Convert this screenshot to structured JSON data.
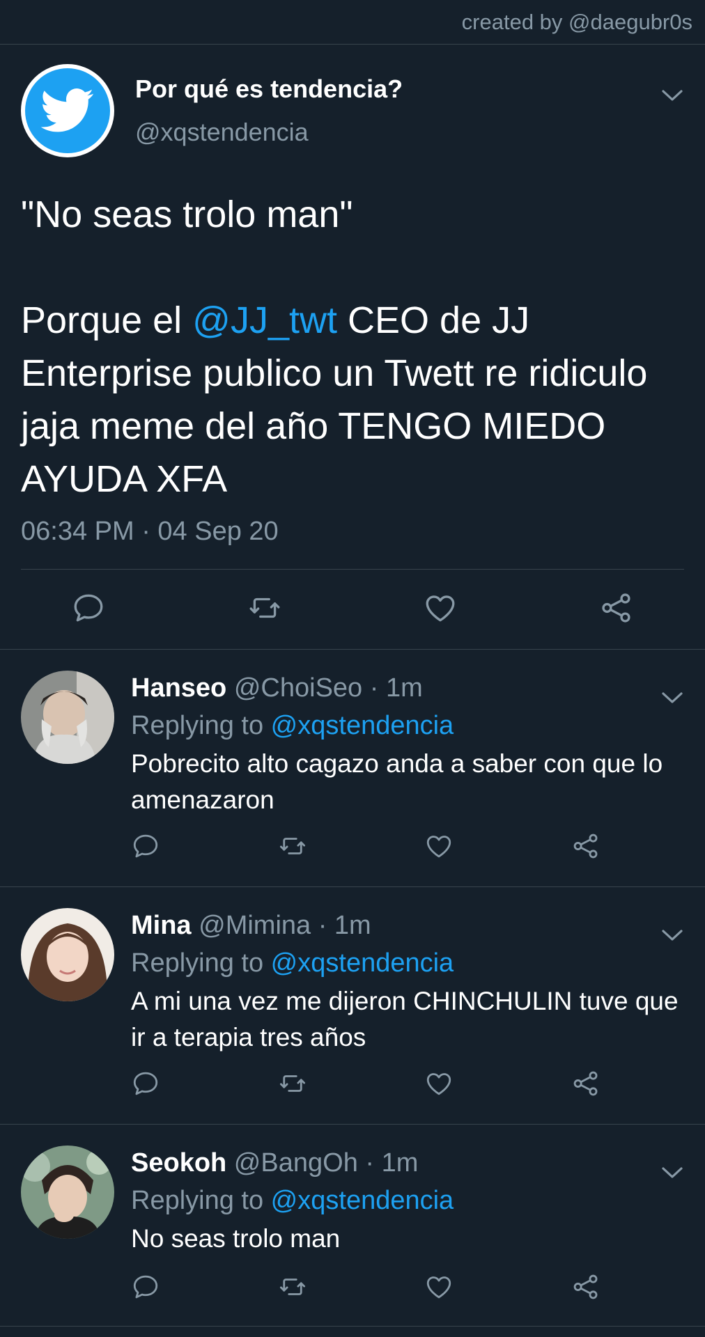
{
  "credit": "created by @daegubr0s",
  "colors": {
    "background": "#15202b",
    "accent": "#1da1f2",
    "secondary_text": "#8899a6",
    "divider": "#38444d"
  },
  "main_tweet": {
    "name": "Por qué es tendencia?",
    "handle": "@xqstendencia",
    "text_line1": "\"No seas trolo man\"",
    "text_pre_mention": "Porque el ",
    "mention": "@JJ_twt",
    "text_post_mention": " CEO de JJ Enterprise publico un Twett re ridiculo jaja meme del año TENGO MIEDO AYUDA XFA",
    "timestamp": "06:34 PM · 04 Sep 20",
    "icons": [
      "twitter-bird-icon",
      "chevron-down-icon",
      "reply-icon",
      "retweet-icon",
      "like-icon",
      "share-icon"
    ]
  },
  "replies": [
    {
      "name": "Hanseo",
      "meta": " @ChoiSeo · 1m",
      "replying_label": "Replying to ",
      "replying_handle": "@xqstendencia",
      "text": "Pobrecito alto cagazo anda a saber con que lo amenazaron"
    },
    {
      "name": "Mina",
      "meta": " @Mimina · 1m",
      "replying_label": "Replying to ",
      "replying_handle": "@xqstendencia",
      "text": "A mi una vez me dijeron CHINCHULIN tuve que ir a terapia tres años"
    },
    {
      "name": "Seokoh",
      "meta": " @BangOh · 1m",
      "replying_label": "Replying to ",
      "replying_handle": "@xqstendencia",
      "text": "No seas trolo man"
    }
  ]
}
